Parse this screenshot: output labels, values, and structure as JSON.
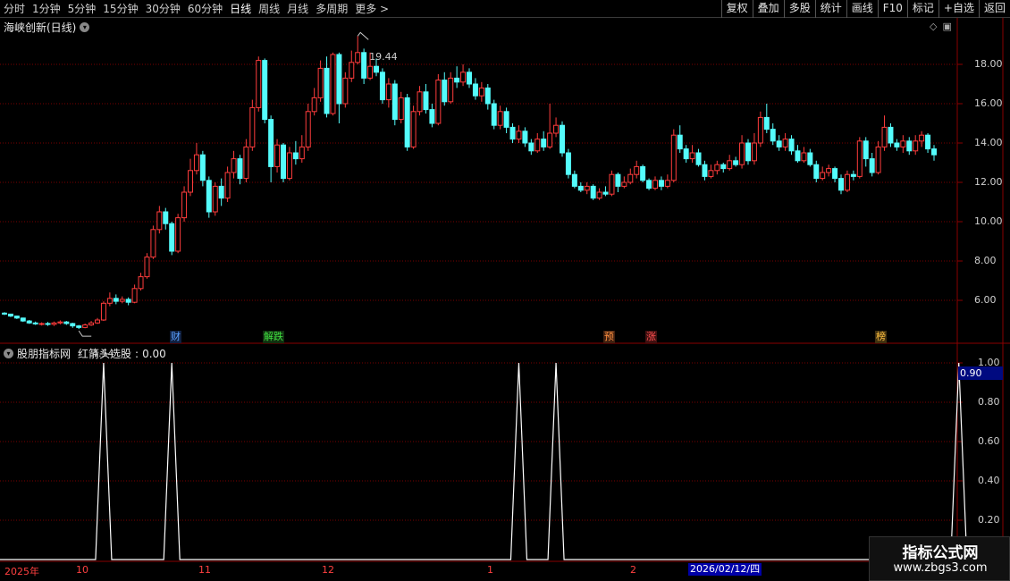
{
  "toolbar": {
    "periods": [
      "分时",
      "1分钟",
      "5分钟",
      "15分钟",
      "30分钟",
      "60分钟",
      "日线",
      "周线",
      "月线",
      "多周期",
      "更多 >"
    ],
    "active_period": "日线",
    "actions": [
      "复权",
      "叠加",
      "多股",
      "统计",
      "画线",
      "F10",
      "标记",
      "+自选",
      "返回"
    ]
  },
  "stock": {
    "title": "海峡创新(日线)",
    "high_marker": "19.44",
    "low_marker": "4.54",
    "price_axis": [
      "18.00",
      "16.00",
      "14.00",
      "12.00",
      "10.00",
      "8.00",
      "6.00"
    ]
  },
  "event_tags": [
    {
      "label": "财",
      "color": "#5aa0ff",
      "bg": "#102040"
    },
    {
      "label": "解跌",
      "color": "#40e040",
      "bg": "#103010"
    },
    {
      "label": "预",
      "color": "#ff9040",
      "bg": "#402010"
    },
    {
      "label": "涨",
      "color": "#ff5050",
      "bg": "#401010"
    },
    {
      "label": "榜",
      "color": "#ffc040",
      "bg": "#403010"
    }
  ],
  "indicator": {
    "source": "股朋指标网",
    "name": "红箭头选股",
    "value_text": "0.00",
    "axis": [
      "1.00",
      "0.80",
      "0.60",
      "0.40",
      "0.20"
    ],
    "current_value": "0.90",
    "signal_day_indices": [
      16,
      27,
      83,
      89,
      154,
      183,
      212
    ]
  },
  "time_axis": {
    "labels": [
      "2025年",
      "10",
      "11",
      "12",
      "1",
      "2"
    ],
    "cursor": "2026/02/12/四"
  },
  "watermark": {
    "title": "指标公式网",
    "url": "www.zbgs3.com"
  },
  "colors": {
    "up": "#ff3c3c",
    "down": "#54fcfc",
    "grid": "#7a0000",
    "indicator_line": "#ffffff"
  },
  "chart_data": {
    "type": "candlestick",
    "title": "海峡创新(日线)",
    "y_range": [
      4.0,
      19.8
    ],
    "price_high": 19.44,
    "price_low": 4.54,
    "candles": [
      [
        5.35,
        5.3,
        5.4,
        5.25
      ],
      [
        5.3,
        5.2,
        5.32,
        5.15
      ],
      [
        5.2,
        5.1,
        5.22,
        5.05
      ],
      [
        5.1,
        4.95,
        5.12,
        4.9
      ],
      [
        4.95,
        4.85,
        5.0,
        4.8
      ],
      [
        4.85,
        4.8,
        4.92,
        4.75
      ],
      [
        4.8,
        4.82,
        4.88,
        4.72
      ],
      [
        4.82,
        4.78,
        4.9,
        4.7
      ],
      [
        4.78,
        4.85,
        4.92,
        4.7
      ],
      [
        4.85,
        4.9,
        4.98,
        4.78
      ],
      [
        4.9,
        4.82,
        4.95,
        4.75
      ],
      [
        4.82,
        4.7,
        4.86,
        4.6
      ],
      [
        4.7,
        4.62,
        4.75,
        4.54
      ],
      [
        4.62,
        4.75,
        4.82,
        4.58
      ],
      [
        4.75,
        4.85,
        4.95,
        4.7
      ],
      [
        4.85,
        5.0,
        5.1,
        4.8
      ],
      [
        5.0,
        5.85,
        5.95,
        4.95
      ],
      [
        5.85,
        6.1,
        6.4,
        5.7
      ],
      [
        6.1,
        5.95,
        6.3,
        5.8
      ],
      [
        5.95,
        6.05,
        6.2,
        5.85
      ],
      [
        6.05,
        5.9,
        6.15,
        5.75
      ],
      [
        5.9,
        6.6,
        6.8,
        5.85
      ],
      [
        6.6,
        7.2,
        7.4,
        6.5
      ],
      [
        7.2,
        8.2,
        8.4,
        7.1
      ],
      [
        8.2,
        9.6,
        9.8,
        8.1
      ],
      [
        9.6,
        10.5,
        10.8,
        9.4
      ],
      [
        10.5,
        9.9,
        10.7,
        9.6
      ],
      [
        9.9,
        8.5,
        10.0,
        8.3
      ],
      [
        8.5,
        10.2,
        10.4,
        8.4
      ],
      [
        10.2,
        11.5,
        11.8,
        10.0
      ],
      [
        11.5,
        12.6,
        13.2,
        11.3
      ],
      [
        12.6,
        13.4,
        14.0,
        12.4
      ],
      [
        13.4,
        12.1,
        13.6,
        11.8
      ],
      [
        12.1,
        10.5,
        12.3,
        10.2
      ],
      [
        10.5,
        11.8,
        12.0,
        10.3
      ],
      [
        11.8,
        11.2,
        12.2,
        10.8
      ],
      [
        11.2,
        12.5,
        12.8,
        11.0
      ],
      [
        12.5,
        13.2,
        13.6,
        12.2
      ],
      [
        13.2,
        12.2,
        13.4,
        11.9
      ],
      [
        12.2,
        13.8,
        14.2,
        12.0
      ],
      [
        13.8,
        15.8,
        16.2,
        13.6
      ],
      [
        15.8,
        18.2,
        18.4,
        15.6
      ],
      [
        18.2,
        15.2,
        18.3,
        15.0
      ],
      [
        15.2,
        12.8,
        15.4,
        12.0
      ],
      [
        12.8,
        13.9,
        14.2,
        12.5
      ],
      [
        13.9,
        12.2,
        14.0,
        12.0
      ],
      [
        12.2,
        13.5,
        13.8,
        12.1
      ],
      [
        13.5,
        13.2,
        14.1,
        12.9
      ],
      [
        13.2,
        13.8,
        14.4,
        13.0
      ],
      [
        13.8,
        15.6,
        16.0,
        13.6
      ],
      [
        15.6,
        16.3,
        16.8,
        15.4
      ],
      [
        16.3,
        17.8,
        18.2,
        16.1
      ],
      [
        17.8,
        15.5,
        18.4,
        15.3
      ],
      [
        15.5,
        18.5,
        18.6,
        15.4
      ],
      [
        18.5,
        16.0,
        18.6,
        15.0
      ],
      [
        16.0,
        17.3,
        17.6,
        15.8
      ],
      [
        17.3,
        18.1,
        18.7,
        17.1
      ],
      [
        18.1,
        18.6,
        19.44,
        18.0
      ],
      [
        18.6,
        17.3,
        18.8,
        17.0
      ],
      [
        17.3,
        17.9,
        18.6,
        17.2
      ],
      [
        17.9,
        17.6,
        18.3,
        17.4
      ],
      [
        17.6,
        16.2,
        17.8,
        16.0
      ],
      [
        16.2,
        17.0,
        17.3,
        15.8
      ],
      [
        17.0,
        15.2,
        17.2,
        14.9
      ],
      [
        15.2,
        16.3,
        16.6,
        15.0
      ],
      [
        16.3,
        13.8,
        16.5,
        13.6
      ],
      [
        13.8,
        15.6,
        15.9,
        13.7
      ],
      [
        15.6,
        16.6,
        16.9,
        15.4
      ],
      [
        16.6,
        15.7,
        17.0,
        15.5
      ],
      [
        15.7,
        15.0,
        16.0,
        14.8
      ],
      [
        15.0,
        17.2,
        17.5,
        14.9
      ],
      [
        17.2,
        16.1,
        17.6,
        15.9
      ],
      [
        16.1,
        17.3,
        17.6,
        16.0
      ],
      [
        17.3,
        17.1,
        17.9,
        16.8
      ],
      [
        17.1,
        17.6,
        18.0,
        16.9
      ],
      [
        17.6,
        17.0,
        17.8,
        16.8
      ],
      [
        17.0,
        16.4,
        17.3,
        16.2
      ],
      [
        16.4,
        16.8,
        17.1,
        16.1
      ],
      [
        16.8,
        16.0,
        17.0,
        15.7
      ],
      [
        16.0,
        14.9,
        16.2,
        14.7
      ],
      [
        14.9,
        15.6,
        15.9,
        14.7
      ],
      [
        15.6,
        14.8,
        15.8,
        14.5
      ],
      [
        14.8,
        14.2,
        15.0,
        14.0
      ],
      [
        14.2,
        14.6,
        14.9,
        14.0
      ],
      [
        14.6,
        14.0,
        14.8,
        13.8
      ],
      [
        14.0,
        13.6,
        14.2,
        13.4
      ],
      [
        13.6,
        14.2,
        14.5,
        13.5
      ],
      [
        14.2,
        13.8,
        14.6,
        13.6
      ],
      [
        13.8,
        14.5,
        16.0,
        13.7
      ],
      [
        14.5,
        14.9,
        15.3,
        14.3
      ],
      [
        14.9,
        13.5,
        15.1,
        13.3
      ],
      [
        13.5,
        12.4,
        13.7,
        12.2
      ],
      [
        12.4,
        11.8,
        12.6,
        11.7
      ],
      [
        11.8,
        11.6,
        12.0,
        11.5
      ],
      [
        11.6,
        11.8,
        12.0,
        11.4
      ],
      [
        11.8,
        11.2,
        11.9,
        11.1
      ],
      [
        11.2,
        11.5,
        11.7,
        11.1
      ],
      [
        11.5,
        11.4,
        11.8,
        11.3
      ],
      [
        11.4,
        12.4,
        12.6,
        11.3
      ],
      [
        12.4,
        11.8,
        12.5,
        11.5
      ],
      [
        11.8,
        12.0,
        12.3,
        11.7
      ],
      [
        12.0,
        12.4,
        12.7,
        11.9
      ],
      [
        12.4,
        12.8,
        13.1,
        12.2
      ],
      [
        12.8,
        12.1,
        12.9,
        12.0
      ],
      [
        12.1,
        11.7,
        12.2,
        11.6
      ],
      [
        11.7,
        12.1,
        12.3,
        11.6
      ],
      [
        12.1,
        11.8,
        12.3,
        11.6
      ],
      [
        11.8,
        12.1,
        12.4,
        11.7
      ],
      [
        12.1,
        14.4,
        14.7,
        12.0
      ],
      [
        14.4,
        13.7,
        14.9,
        13.5
      ],
      [
        13.7,
        13.2,
        13.9,
        13.0
      ],
      [
        13.2,
        13.5,
        13.9,
        13.0
      ],
      [
        13.5,
        12.9,
        13.7,
        12.8
      ],
      [
        12.9,
        12.3,
        13.1,
        12.1
      ],
      [
        12.3,
        12.6,
        12.9,
        12.2
      ],
      [
        12.6,
        12.9,
        13.1,
        12.4
      ],
      [
        12.9,
        12.7,
        13.0,
        12.5
      ],
      [
        12.7,
        13.1,
        13.4,
        12.6
      ],
      [
        13.1,
        12.9,
        13.3,
        12.8
      ],
      [
        12.9,
        14.0,
        14.4,
        12.7
      ],
      [
        14.0,
        13.1,
        14.2,
        12.9
      ],
      [
        13.1,
        14.0,
        14.5,
        12.9
      ],
      [
        14.0,
        15.3,
        15.6,
        13.8
      ],
      [
        15.3,
        14.7,
        16.0,
        14.5
      ],
      [
        14.7,
        14.1,
        15.0,
        13.9
      ],
      [
        14.1,
        13.8,
        14.4,
        13.6
      ],
      [
        13.8,
        14.2,
        14.5,
        13.6
      ],
      [
        14.2,
        13.6,
        14.4,
        13.4
      ],
      [
        13.6,
        13.1,
        13.9,
        13.0
      ],
      [
        13.1,
        13.5,
        13.8,
        13.0
      ],
      [
        13.5,
        12.9,
        13.7,
        12.8
      ],
      [
        12.9,
        12.2,
        13.1,
        12.0
      ],
      [
        12.2,
        12.5,
        12.8,
        12.1
      ],
      [
        12.5,
        12.7,
        12.9,
        12.3
      ],
      [
        12.7,
        12.2,
        12.8,
        12.0
      ],
      [
        12.2,
        11.6,
        12.4,
        11.4
      ],
      [
        11.6,
        12.4,
        12.6,
        11.5
      ],
      [
        12.4,
        12.3,
        12.6,
        12.1
      ],
      [
        12.3,
        14.1,
        14.3,
        12.2
      ],
      [
        14.1,
        13.2,
        14.3,
        12.8
      ],
      [
        13.2,
        12.5,
        13.5,
        12.3
      ],
      [
        12.5,
        13.8,
        14.1,
        12.4
      ],
      [
        13.8,
        14.8,
        15.4,
        13.6
      ],
      [
        14.8,
        14.0,
        15.0,
        13.8
      ],
      [
        14.0,
        13.8,
        14.2,
        13.6
      ],
      [
        13.8,
        14.1,
        14.4,
        13.5
      ],
      [
        14.1,
        13.6,
        14.3,
        13.4
      ],
      [
        13.6,
        14.1,
        14.4,
        13.4
      ],
      [
        14.1,
        14.4,
        14.6,
        13.8
      ],
      [
        14.4,
        13.7,
        14.5,
        13.5
      ],
      [
        13.7,
        13.4,
        13.9,
        13.1
      ]
    ],
    "indicator_series": {
      "name": "红箭头选股",
      "range": [
        0,
        1
      ],
      "spike_value": 1.0,
      "spike_indices": [
        16,
        27,
        83,
        89,
        154,
        183,
        212
      ]
    }
  }
}
